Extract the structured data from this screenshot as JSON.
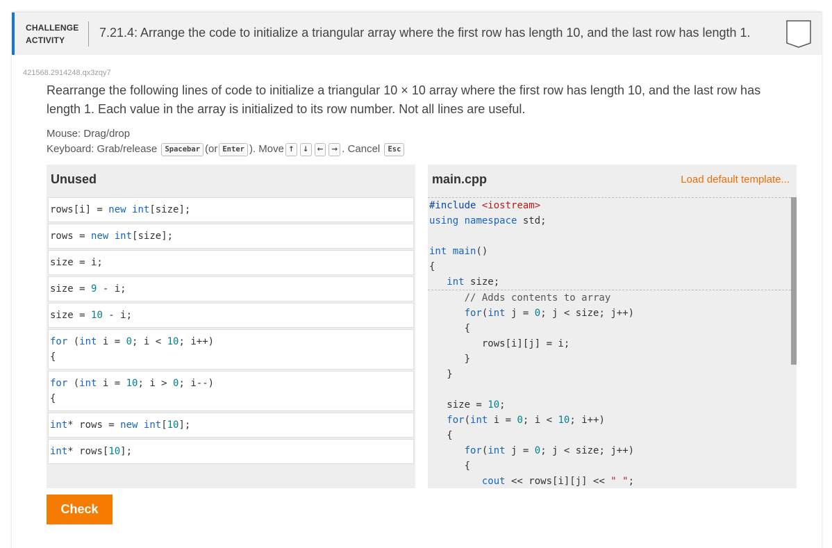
{
  "header": {
    "kind_line1": "CHALLENGE",
    "kind_line2": "ACTIVITY",
    "title": "7.21.4: Arrange the code to initialize a triangular array where the first row has length 10, and the last row has length 1.",
    "badge_icon": "completion-badge-icon"
  },
  "activity_id": "421568.2914248.qx3zqy7",
  "instructions": "Rearrange the following lines of code to initialize a triangular 10 × 10 array where the first row has length 10, and the last row has length 1. Each value in the array is initialized to its row number. Not all lines are useful.",
  "help": {
    "mouse": "Mouse: Drag/drop",
    "keyboard_prefix": "Keyboard: Grab/release",
    "key_spacebar": "Spacebar",
    "or_open": "(or",
    "key_enter": "Enter",
    "move_text": "). Move",
    "key_up": "↑",
    "key_down": "↓",
    "key_left": "←",
    "key_right": "→",
    "cancel_text": ". Cancel",
    "key_esc": "Esc"
  },
  "unused": {
    "title": "Unused",
    "blocks": [
      [
        "rows[i] = new int[size];"
      ],
      [
        "rows = new int[size];"
      ],
      [
        "size = i;"
      ],
      [
        "size = 9 - i;"
      ],
      [
        "size = 10 - i;"
      ],
      [
        "for (int i = 0; i < 10; i++)",
        "{"
      ],
      [
        "for (int i = 10; i > 0; i--)",
        "{"
      ],
      [
        "int* rows = new int[10];"
      ],
      [
        "int* rows[10];"
      ]
    ]
  },
  "editor": {
    "title": "main.cpp",
    "load_link": "Load default template...",
    "lines": [
      "#include <iostream>",
      "using namespace std;",
      "",
      "int main()",
      "{",
      "   int size;",
      "      // Adds contents to array",
      "      for(int j = 0; j < size; j++)",
      "      {",
      "         rows[i][j] = i;",
      "      }",
      "   }",
      "",
      "   size = 10;",
      "   for(int i = 0; i < 10; i++)",
      "   {",
      "      for(int j = 0; j < size; j++)",
      "      {",
      "         cout << rows[i][j] << \" \";"
    ]
  },
  "check_label": "Check",
  "colors": {
    "accent": "#1976d2",
    "check": "#f57c00",
    "link": "#ef6c00"
  }
}
